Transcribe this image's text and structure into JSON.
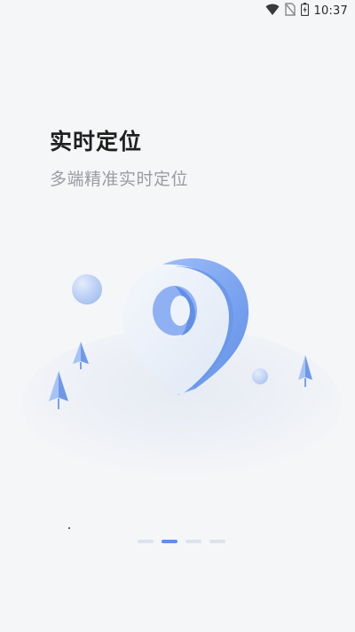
{
  "status_bar": {
    "time": "10:37",
    "icons": [
      "wifi-icon",
      "no-sim-icon",
      "battery-icon"
    ]
  },
  "onboarding": {
    "title": "实时定位",
    "subtitle": "多端精准实时定位",
    "illustration": "location-pin-icon",
    "page_indicator": {
      "total": 4,
      "active_index": 1
    }
  },
  "colors": {
    "background": "#f5f6f8",
    "accent": "#5f8fe8",
    "dot_inactive": "#dce3ec",
    "title": "#1f1f1f",
    "subtitle": "#9a9ca1"
  }
}
